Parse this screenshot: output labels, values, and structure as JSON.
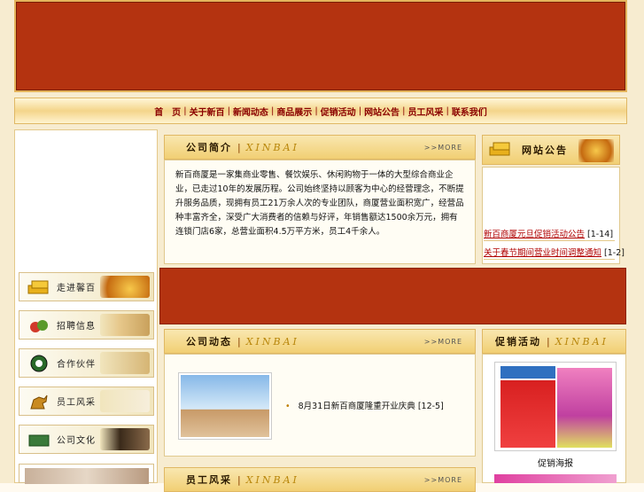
{
  "nav": {
    "items": [
      "首　页",
      "关于新百",
      "新闻动态",
      "商品展示",
      "促销活动",
      "网站公告",
      "员工风采",
      "联系我们"
    ],
    "separator": "|"
  },
  "sidebar": {
    "items": [
      {
        "label": "走进馨百",
        "icon": "gold-bars-icon"
      },
      {
        "label": "招聘信息",
        "icon": "vegetables-icon"
      },
      {
        "label": "合作伙伴",
        "icon": "soccer-ball-icon"
      },
      {
        "label": "员工风采",
        "icon": "horse-statue-icon"
      },
      {
        "label": "公司文化",
        "icon": "garden-icon"
      }
    ]
  },
  "intro": {
    "title": "公司简介",
    "brand": "XINBAI",
    "more": ">>MORE",
    "text": "新百商厦是一家集商业零售、餐饮娱乐、休闲购物于一体的大型综合商业企业，已走过10年的发展历程。公司始终坚持以顾客为中心的经营理念，不断提升服务品质，现拥有员工21万余人次的专业团队，商厦营业面积宽广，经营品种丰富齐全，深受广大消费者的信赖与好评，年销售额达1500余万元，拥有连锁门店6家，总营业面积4.5万平方米，员工4千余人。"
  },
  "notice": {
    "title": "网站公告",
    "items": [
      {
        "text": "新百商厦元旦促销活动公告",
        "date": "[1-14]"
      },
      {
        "text": "关于春节期间营业时间调整通知",
        "date": "[1-2]"
      }
    ]
  },
  "news": {
    "title": "公司动态",
    "brand": "XINBAI",
    "more": ">>MORE",
    "bullet": "•",
    "items": [
      {
        "text": "8月31日新百商厦隆重开业庆典",
        "date": "[12-5]"
      }
    ]
  },
  "promo": {
    "title": "促销活动",
    "brand": "XINBAI",
    "caption": "促销海报"
  },
  "staff": {
    "title": "员工风采",
    "brand": "XINBAI",
    "more": ">>MORE"
  }
}
